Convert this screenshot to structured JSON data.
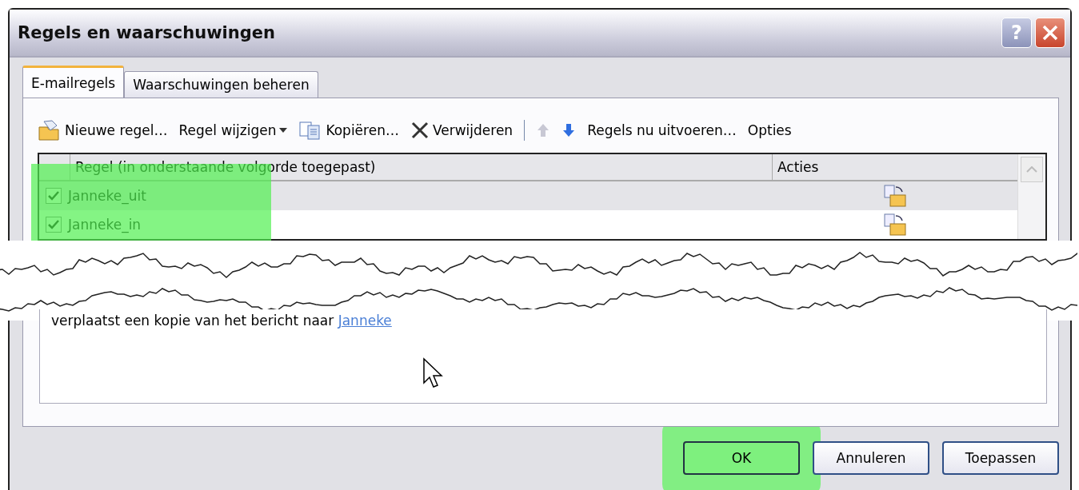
{
  "window": {
    "title": "Regels en waarschuwingen",
    "help_label": "?"
  },
  "tabs": [
    {
      "label": "E-mailregels",
      "selected": true
    },
    {
      "label": "Waarschuwingen beheren",
      "selected": false
    }
  ],
  "toolbar": [
    {
      "kind": "new",
      "label": "Nieuwe regel…"
    },
    {
      "kind": "menu",
      "label": "Regel wijzigen"
    },
    {
      "kind": "copy",
      "label": "Kopiëren…"
    },
    {
      "kind": "delete",
      "label": "Verwijderen"
    },
    {
      "kind": "separator"
    },
    {
      "kind": "up",
      "disabled": true
    },
    {
      "kind": "down",
      "disabled": false
    },
    {
      "kind": "plain",
      "label": "Regels nu uitvoeren…"
    },
    {
      "kind": "plain",
      "label": "Opties"
    }
  ],
  "rules_list": {
    "columns": [
      "Regel (in onderstaande volgorde toegepast)",
      "Acties"
    ],
    "check_column_highlighted": true,
    "rows": [
      {
        "name": "Janneke_uit",
        "checked": true,
        "selected": true
      },
      {
        "name": "Janneke_in",
        "checked": true,
        "selected": false
      }
    ]
  },
  "description": {
    "text": "verplaatst een kopie van het bericht naar",
    "link": "Janneke"
  },
  "buttons": [
    {
      "label": "OK",
      "highlighted": true
    },
    {
      "label": "Annuleren",
      "highlighted": false
    },
    {
      "label": "Toepassen",
      "highlighted": false
    }
  ]
}
